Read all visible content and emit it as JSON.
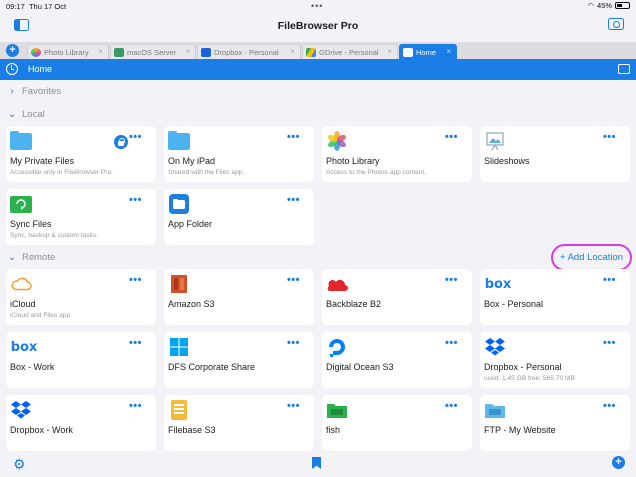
{
  "status_bar": {
    "time": "09:17",
    "date": "Thu 17 Oct",
    "battery": "45%"
  },
  "app": {
    "title": "FileBrowser Pro"
  },
  "tabs": [
    {
      "label": "Photo Library"
    },
    {
      "label": "macOS Server"
    },
    {
      "label": "Dropbox - Personal"
    },
    {
      "label": "GDrive - Personal"
    },
    {
      "label": "Home"
    }
  ],
  "path": {
    "current": "Home"
  },
  "sections": {
    "favorites": "Favorites",
    "local": "Local",
    "remote": "Remote"
  },
  "add_location": "+ Add Location",
  "local_items": [
    {
      "name": "My Private Files",
      "subtitle": "Accessible only in FileBrowser Pro."
    },
    {
      "name": "On My iPad",
      "subtitle": "Shared with the Files app."
    },
    {
      "name": "Photo Library",
      "subtitle": "Access to the Photos app content."
    },
    {
      "name": "Slideshows",
      "subtitle": ""
    },
    {
      "name": "Sync Files",
      "subtitle": "Sync, backup & custom tasks."
    },
    {
      "name": "App Folder",
      "subtitle": ""
    }
  ],
  "remote_items": [
    {
      "name": "iCloud",
      "subtitle": "iCloud and Files app."
    },
    {
      "name": "Amazon S3",
      "subtitle": ""
    },
    {
      "name": "Backblaze B2",
      "subtitle": ""
    },
    {
      "name": "Box - Personal",
      "subtitle": ""
    },
    {
      "name": "Box - Work",
      "subtitle": ""
    },
    {
      "name": "DFS Corporate Share",
      "subtitle": ""
    },
    {
      "name": "Digital Ocean S3",
      "subtitle": ""
    },
    {
      "name": "Dropbox - Personal",
      "subtitle": "used: 1.45 GB free: 565.70 MB"
    },
    {
      "name": "Dropbox - Work",
      "subtitle": ""
    },
    {
      "name": "Filebase S3",
      "subtitle": ""
    },
    {
      "name": "fish",
      "subtitle": ""
    },
    {
      "name": "FTP - My Website",
      "subtitle": ""
    }
  ],
  "more_label": "•••",
  "colors": {
    "accent": "#1a7ee6",
    "highlight": "#d63ce3"
  }
}
